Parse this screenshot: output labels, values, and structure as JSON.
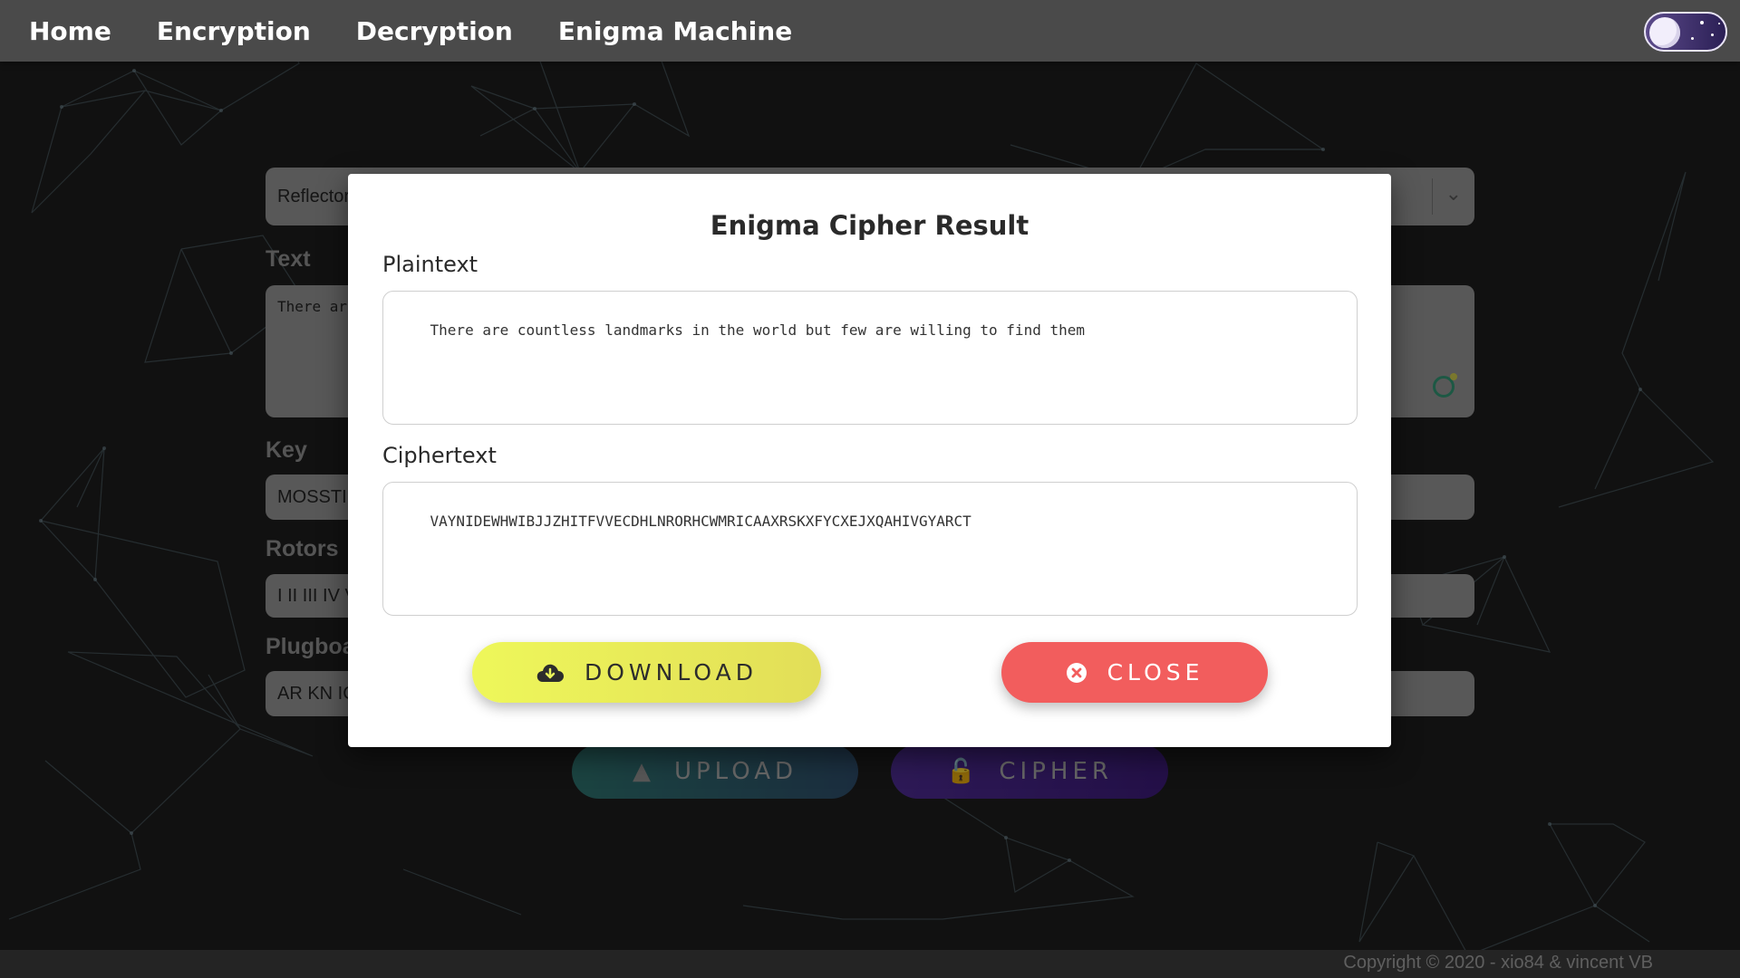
{
  "nav": {
    "items": [
      {
        "label": "Home"
      },
      {
        "label": "Encryption"
      },
      {
        "label": "Decryption"
      },
      {
        "label": "Enigma Machine"
      }
    ]
  },
  "form": {
    "reflector_value": "Reflector",
    "text_label": "Text",
    "text_value": "There ar",
    "key_label": "Key",
    "key_value": "MOSSTI",
    "rotors_label": "Rotors",
    "rotors_value": "I II III IV V",
    "plugboard_label": "Plugboa",
    "plugboard_value": "AR KN IC",
    "upload_label": "UPLOAD",
    "cipher_label": "CIPHER"
  },
  "modal": {
    "title": "Enigma Cipher Result",
    "plaintext_label": "Plaintext",
    "plaintext_value": "There are countless landmarks in the world but few are willing to find them",
    "ciphertext_label": "Ciphertext",
    "ciphertext_value": "VAYNIDEWHWIBJJZHITFVVECDHLNRORHCWMRICAAXRSKXFYCXEJXQAHIVGYARCT",
    "download_label": "DOWNLOAD",
    "close_label": "CLOSE"
  },
  "footer": {
    "copyright": "Copyright © 2020 - xio84 & vincent VB"
  },
  "colors": {
    "navbar": "#4a4a4a",
    "background": "#1c1c1c",
    "download_button": "#e9f45a",
    "close_button": "#f25d5d",
    "upload_button": "#2d6e6a",
    "cipher_button": "#4a2a8c"
  },
  "icons": {
    "theme_toggle": "moon-icon",
    "download": "cloud-download-icon",
    "close": "close-circle-icon",
    "upload": "file-upload-icon",
    "cipher": "lock-open-icon",
    "select_caret": "chevron-down-icon"
  }
}
